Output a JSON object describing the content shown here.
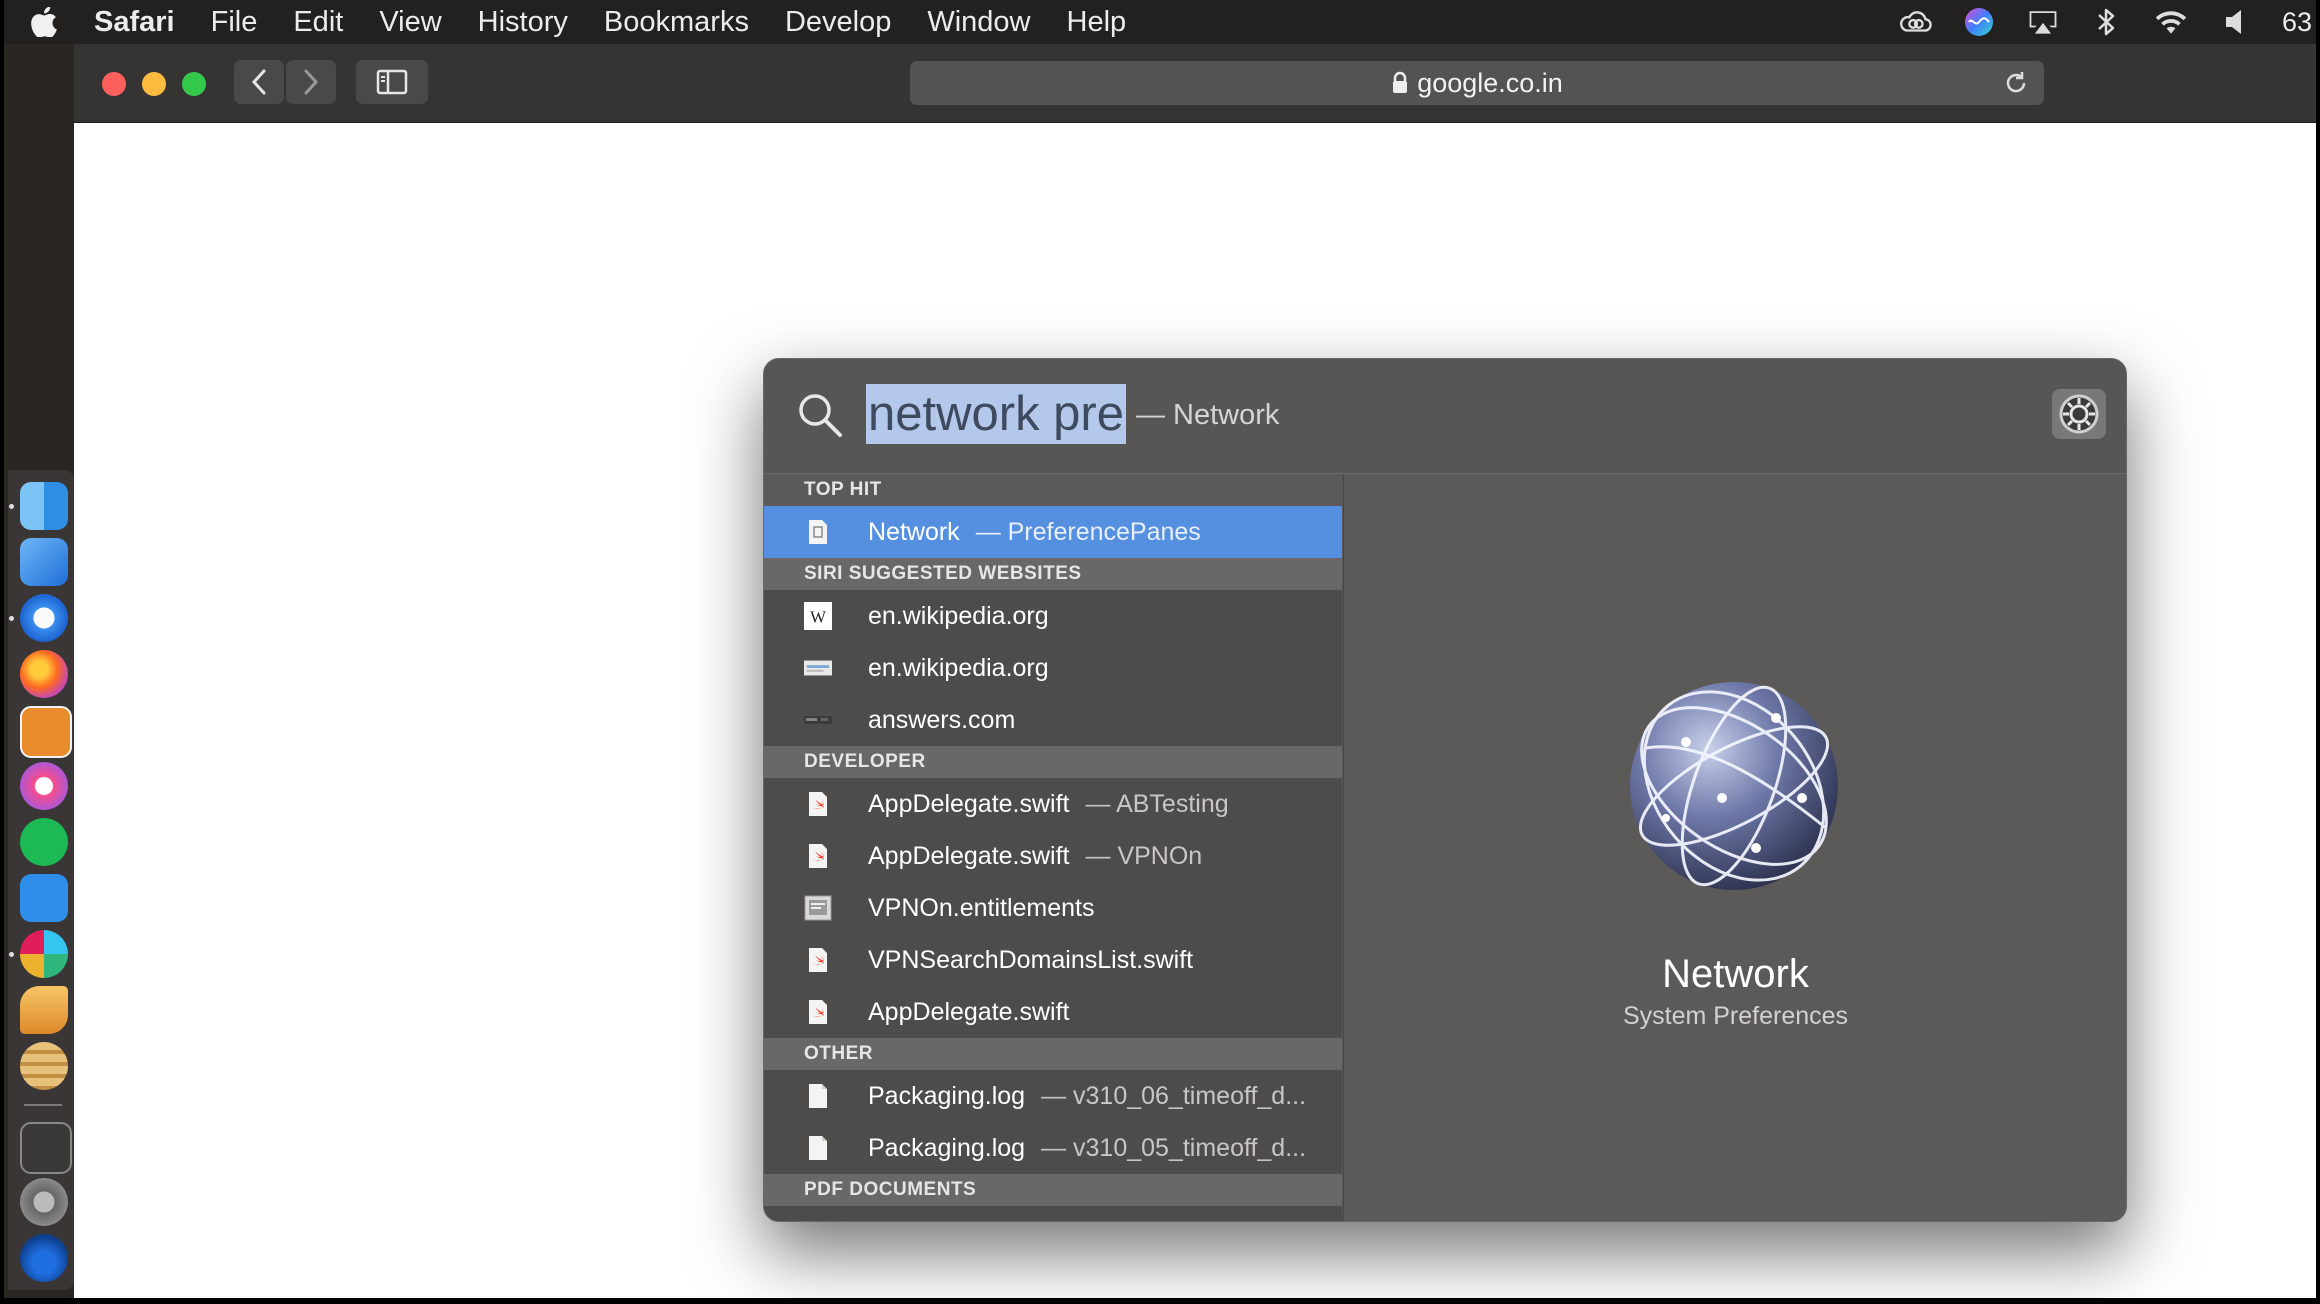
{
  "menubar": {
    "app": "Safari",
    "items": [
      "File",
      "Edit",
      "View",
      "History",
      "Bookmarks",
      "Develop",
      "Window",
      "Help"
    ],
    "battery": "63"
  },
  "browser": {
    "url": "google.co.in"
  },
  "spotlight": {
    "query": "network pre",
    "completion": "— Network",
    "sections": {
      "top_hit": "TOP HIT",
      "siri": "SIRI SUGGESTED WEBSITES",
      "developer": "DEVELOPER",
      "other": "OTHER",
      "pdf": "PDF DOCUMENTS"
    },
    "top_hit": {
      "title": "Network",
      "subtitle": "— PreferencePanes"
    },
    "siri_items": [
      {
        "title": "en.wikipedia.org"
      },
      {
        "title": "en.wikipedia.org"
      },
      {
        "title": "answers.com"
      }
    ],
    "developer_items": [
      {
        "title": "AppDelegate.swift",
        "subtitle": "— ABTesting"
      },
      {
        "title": "AppDelegate.swift",
        "subtitle": "— VPNOn"
      },
      {
        "title": "VPNOn.entitlements",
        "subtitle": ""
      },
      {
        "title": "VPNSearchDomainsList.swift",
        "subtitle": ""
      },
      {
        "title": "AppDelegate.swift",
        "subtitle": ""
      }
    ],
    "other_items": [
      {
        "title": "Packaging.log",
        "subtitle": "— v310_06_timeoff_d..."
      },
      {
        "title": "Packaging.log",
        "subtitle": "— v310_05_timeoff_d..."
      }
    ],
    "preview": {
      "title": "Network",
      "subtitle": "System Preferences"
    }
  },
  "colors": {
    "selection": "#5590e0",
    "query_highlight": "#b3c8ea"
  }
}
